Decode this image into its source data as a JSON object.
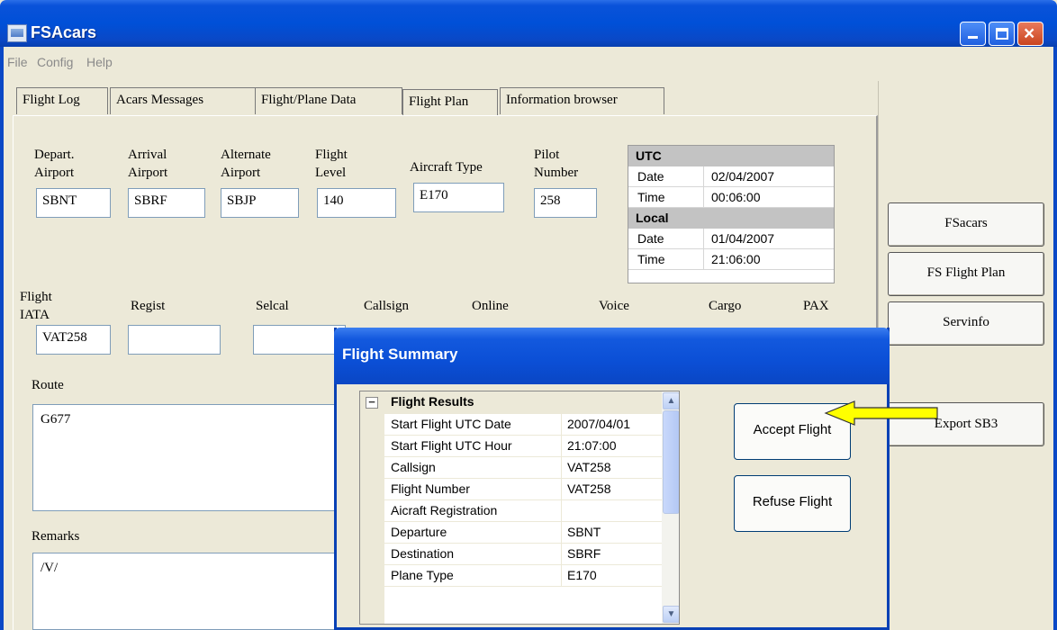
{
  "window": {
    "title": "FSAcars"
  },
  "menu": [
    "File",
    "Config",
    "Help"
  ],
  "tabs": [
    "Flight Log",
    "Acars Messages",
    "Flight/Plane Data",
    "Flight Plan",
    "Information browser"
  ],
  "active_tab": "Flight Plan",
  "plan": {
    "depart_label_1": "Depart.",
    "depart_label_2": "Airport",
    "depart_value": "SBNT",
    "arrival_label_1": "Arrival",
    "arrival_label_2": "Airport",
    "arrival_value": "SBRF",
    "alternate_label_1": "Alternate",
    "alternate_label_2": "Airport",
    "alternate_value": "SBJP",
    "level_label_1": "Flight",
    "level_label_2": "Level",
    "level_value": "140",
    "aircraft_label": "Aircraft Type",
    "aircraft_value": "E170",
    "pilot_label_1": "Pilot",
    "pilot_label_2": "Number",
    "pilot_value": "258",
    "iata_label_1": "Flight",
    "iata_label_2": "IATA",
    "iata_value": "VAT258",
    "regist_label": "Regist",
    "selcal_label": "Selcal",
    "callsign_label": "Callsign",
    "online_label": "Online",
    "voice_label": "Voice",
    "cargo_label": "Cargo",
    "pax_label": "PAX",
    "route_label": "Route",
    "route_value": "G677",
    "remarks_label": "Remarks",
    "remarks_value": "/V/"
  },
  "time": {
    "utc_header": "UTC",
    "local_header": "Local",
    "date_label": "Date",
    "time_label": "Time",
    "utc_date": "02/04/2007",
    "utc_time": "00:06:00",
    "local_date": "01/04/2007",
    "local_time": "21:06:00"
  },
  "side_buttons": {
    "fsacars": "FSacars",
    "fs_flight_plan": "FS Flight Plan",
    "servinfo": "Servinfo",
    "export_sb3": "Export SB3"
  },
  "dialog": {
    "title": "Flight Summary",
    "category": "Flight Results",
    "collapse_glyph": "−",
    "rows": [
      {
        "key": "Start Flight UTC Date",
        "value": "2007/04/01"
      },
      {
        "key": "Start Flight UTC Hour",
        "value": "21:07:00"
      },
      {
        "key": "Callsign",
        "value": "VAT258"
      },
      {
        "key": "Flight Number",
        "value": "VAT258"
      },
      {
        "key": "Aicraft Registration",
        "value": ""
      },
      {
        "key": "Departure",
        "value": "SBNT"
      },
      {
        "key": "Destination",
        "value": "SBRF"
      },
      {
        "key": "Plane Type",
        "value": "E170"
      }
    ],
    "accept_label": "Accept Flight",
    "refuse_label": "Refuse Flight"
  },
  "colors": {
    "titlebar": "#0050d8",
    "arrow": "#ffff00",
    "face": "#ECE9D8"
  }
}
